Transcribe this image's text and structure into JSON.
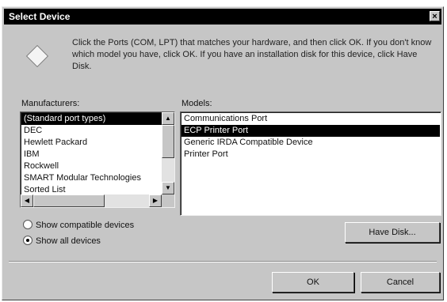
{
  "window": {
    "title": "Select Device",
    "close_glyph": "×"
  },
  "description": "Click the Ports (COM, LPT) that matches your hardware, and then click OK. If you don't know which model you have, click OK. If you have an installation disk for this device, click Have Disk.",
  "manufacturers": {
    "label": "Manufacturers:",
    "items": [
      "(Standard port types)",
      "DEC",
      "Hewlett Packard",
      "IBM",
      "Rockwell",
      "SMART Modular Technologies",
      "Sorted List"
    ],
    "selected_index": 0
  },
  "models": {
    "label": "Models:",
    "items": [
      "Communications Port",
      "ECP Printer Port",
      "Generic IRDA Compatible Device",
      "Printer Port"
    ],
    "selected_index": 1
  },
  "options": {
    "compatible": "Show compatible devices",
    "all": "Show all devices",
    "selected": "all"
  },
  "buttons": {
    "have_disk": "Have Disk...",
    "ok": "OK",
    "cancel": "Cancel"
  },
  "colors": {
    "titlebar": "#000000",
    "face": "#c6c6c6",
    "selection": "#000000"
  }
}
